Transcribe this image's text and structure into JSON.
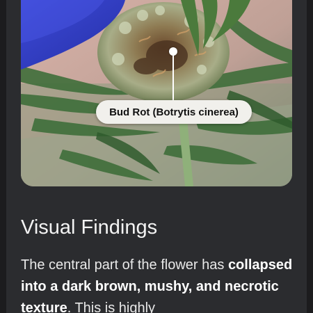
{
  "annotation": {
    "label": "Bud Rot (Botrytis cinerea)"
  },
  "findings": {
    "title": "Visual Findings",
    "text_plain_1": "The central part of the flower has ",
    "text_bold": "collapsed into a dark brown, mushy, and necrotic texture",
    "text_plain_2": ". This is highly"
  },
  "colors": {
    "background": "#1c1c1e",
    "card": "#2b2c2f",
    "label_pill": "#f1f0ec"
  },
  "icons": {
    "marker": "annotation-pin"
  }
}
